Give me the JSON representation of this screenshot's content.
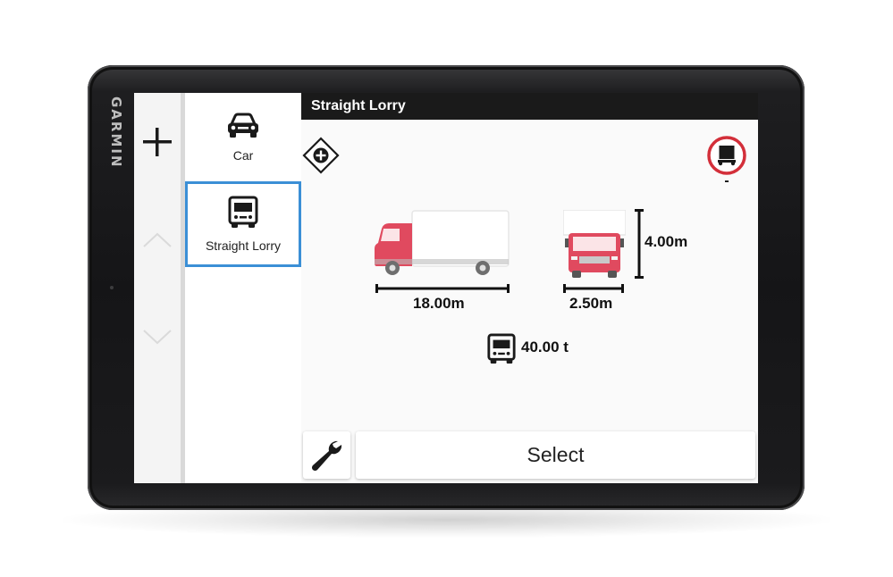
{
  "device": {
    "brand": "GARMIN"
  },
  "rail": {
    "add_icon": "plus-icon",
    "up_icon": "chevron-up-icon",
    "down_icon": "chevron-down-icon"
  },
  "profiles": [
    {
      "label": "Car",
      "icon": "car-icon",
      "selected": false
    },
    {
      "label": "Straight Lorry",
      "icon": "lorry-icon",
      "selected": true
    }
  ],
  "header": {
    "title": "Straight Lorry"
  },
  "hazmat": {
    "icon": "hazmat-plus-icon"
  },
  "restriction": {
    "icon": "no-trailer-sign-icon",
    "value": "-"
  },
  "vehicle": {
    "length": "18.00m",
    "width": "2.50m",
    "height": "4.00m",
    "weight": "40.00 t",
    "body_color": "#e04a5f"
  },
  "actions": {
    "settings_icon": "wrench-icon",
    "select_label": "Select"
  }
}
